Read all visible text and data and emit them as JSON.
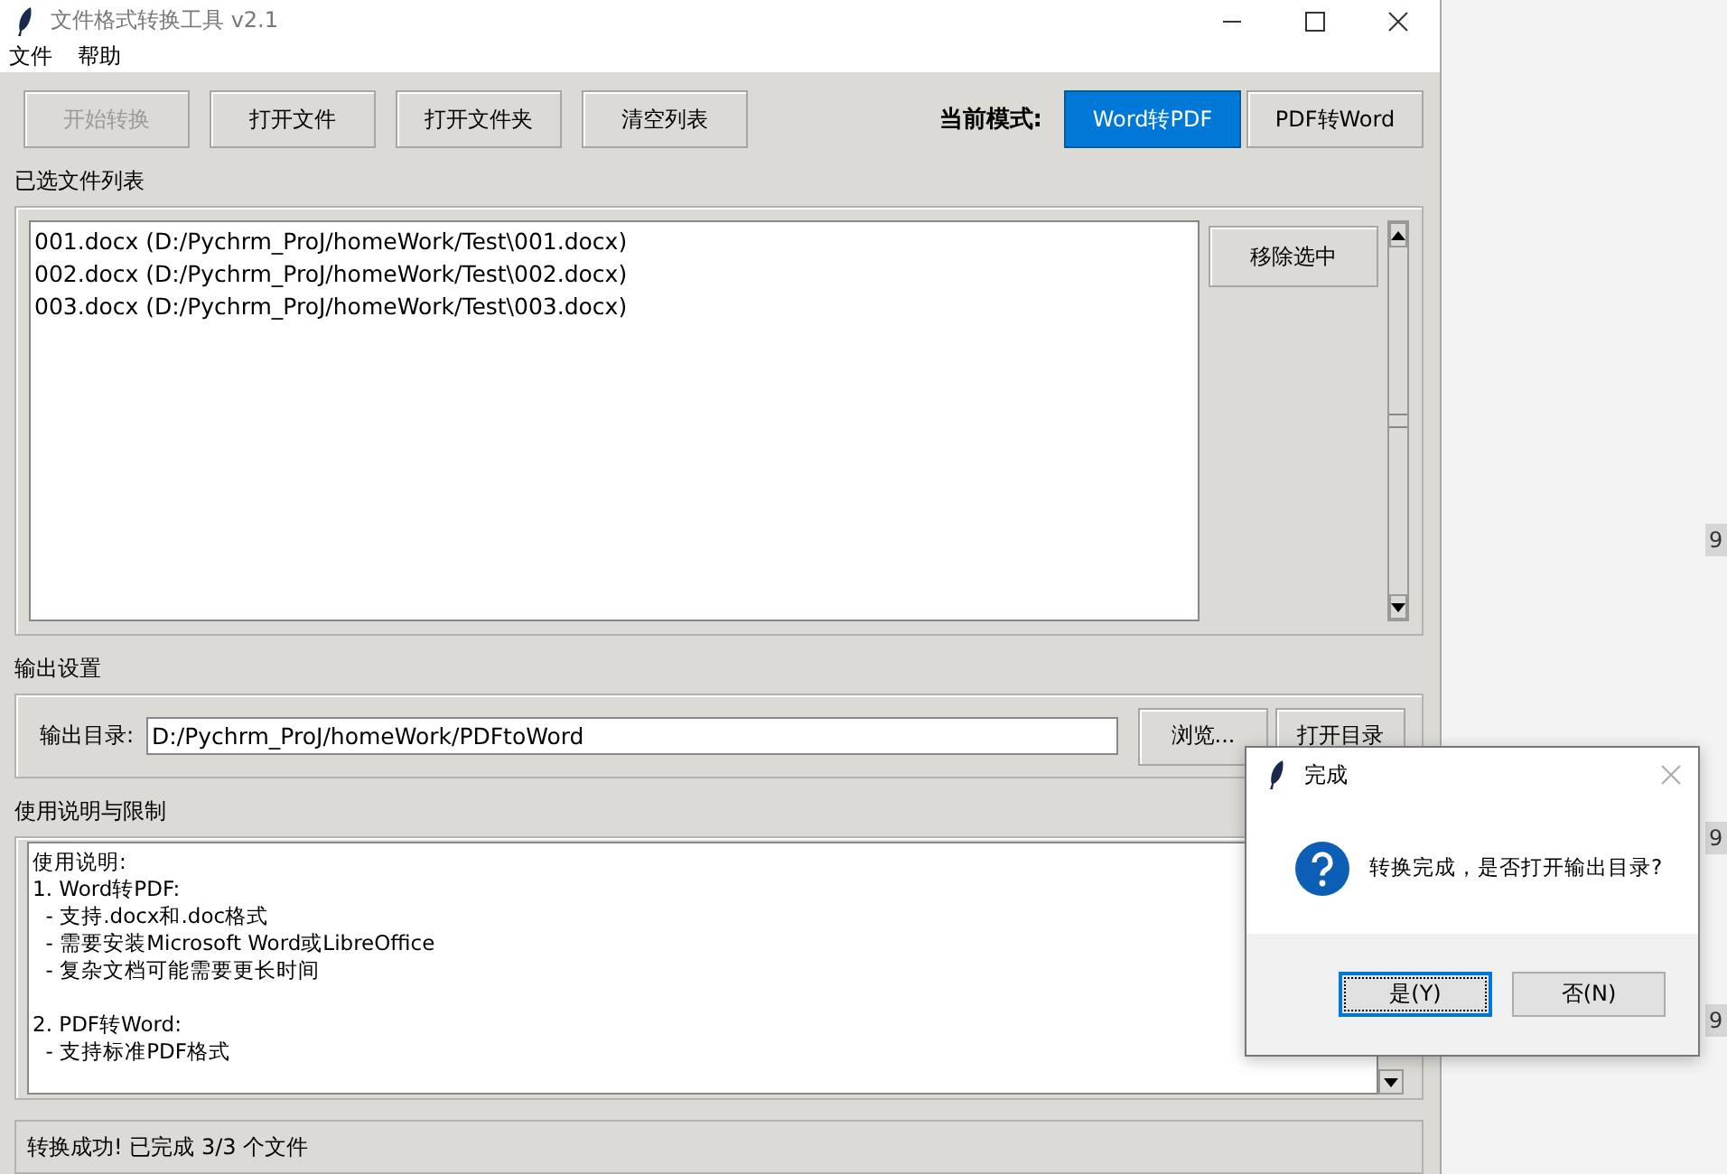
{
  "window": {
    "title": "文件格式转换工具 v2.1"
  },
  "menu": [
    "文件",
    "帮助"
  ],
  "toolbar": {
    "buttons": [
      {
        "label": "开始转换",
        "disabled": true
      },
      {
        "label": "打开文件",
        "disabled": false
      },
      {
        "label": "打开文件夹",
        "disabled": false
      },
      {
        "label": "清空列表",
        "disabled": false
      }
    ],
    "mode_label": "当前模式:",
    "modes": [
      {
        "label": "Word转PDF",
        "selected": true
      },
      {
        "label": "PDF转Word",
        "selected": false
      }
    ]
  },
  "file_list": {
    "title": "已选文件列表",
    "items": [
      {
        "text": "001.docx (D:/Pychrm_ProJ/homeWork/Test\\001.docx)",
        "selected": false
      },
      {
        "text": "002.docx (D:/Pychrm_ProJ/homeWork/Test\\002.docx)",
        "selected": false
      },
      {
        "text": "003.docx (D:/Pychrm_ProJ/homeWork/Test\\003.docx)",
        "selected": false
      }
    ],
    "remove_button": "移除选中"
  },
  "output": {
    "title": "输出设置",
    "label": "输出目录:",
    "value": "D:/Pychrm_ProJ/homeWork/PDFtoWord",
    "browse_button": "浏览...",
    "open_button": "打开目录"
  },
  "instructions": {
    "title": "使用说明与限制",
    "blocks": [
      [
        "使用说明:",
        "1. Word转PDF:",
        "  - 支持.docx和.doc格式",
        "  - 需要安装Microsoft Word或LibreOffice",
        "  - 复杂文档可能需要更长时间"
      ],
      [
        "2. PDF转Word:",
        "  - 支持标准PDF格式"
      ]
    ]
  },
  "status_bar": "转换成功! 已完成 3/3 个文件",
  "dialog": {
    "title": "完成",
    "message": "转换完成，是否打开输出目录?",
    "buttons": [
      {
        "label": "是(Y)",
        "selected": true
      },
      {
        "label": "否(N)",
        "selected": false
      }
    ]
  },
  "background_badges": [
    "9",
    "9",
    "9"
  ]
}
